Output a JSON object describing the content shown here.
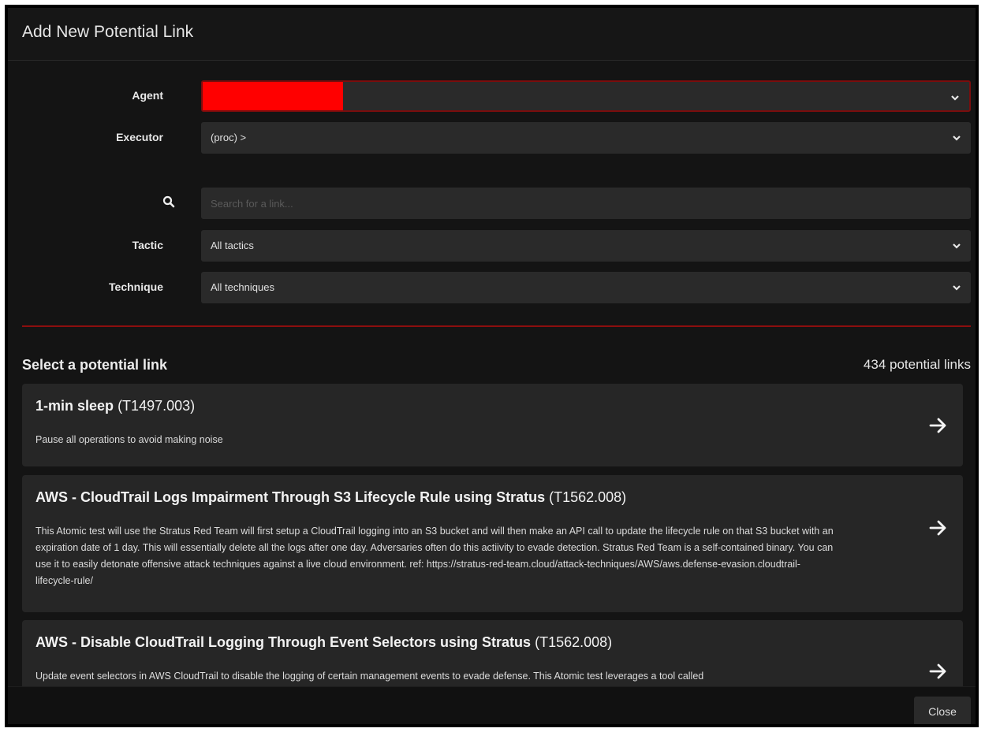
{
  "modal": {
    "title": "Add New Potential Link"
  },
  "form": {
    "agent": {
      "label": "Agent",
      "value": ""
    },
    "executor": {
      "label": "Executor",
      "value": "(proc) >"
    },
    "search": {
      "icon": "search-icon",
      "placeholder": "Search for a link..."
    },
    "tactic": {
      "label": "Tactic",
      "value": "All tactics"
    },
    "technique": {
      "label": "Technique",
      "value": "All techniques"
    }
  },
  "results": {
    "heading": "Select a potential link",
    "count": "434 potential links",
    "links": [
      {
        "name": "1-min sleep",
        "technique_id": "(T1497.003)",
        "description": "Pause all operations to avoid making noise"
      },
      {
        "name": "AWS - CloudTrail Logs Impairment Through S3 Lifecycle Rule using Stratus",
        "technique_id": "(T1562.008)",
        "description": "This Atomic test will use the Stratus Red Team will first setup a CloudTrail logging into an S3 bucket and will then make an API call to update the lifecycle rule on that S3 bucket with an expiration date of 1 day. This will essentially delete all the logs after one day. Adversaries often do this actiivity to evade detection. Stratus Red Team is a self-contained binary. You can use it to easily detonate offensive attack techniques against a live cloud environment. ref: https://stratus-red-team.cloud/attack-techniques/AWS/aws.defense-evasion.cloudtrail-lifecycle-rule/"
      },
      {
        "name": "AWS - Disable CloudTrail Logging Through Event Selectors using Stratus",
        "technique_id": "(T1562.008)",
        "description": "Update event selectors in AWS CloudTrail to disable the logging of certain management events to evade defense. This Atomic test leverages a tool called"
      }
    ]
  },
  "footer": {
    "close_label": "Close"
  },
  "colors": {
    "accent": "#8c0e0e",
    "redaction": "#ff0000",
    "background": "#141414",
    "card": "#262626"
  }
}
